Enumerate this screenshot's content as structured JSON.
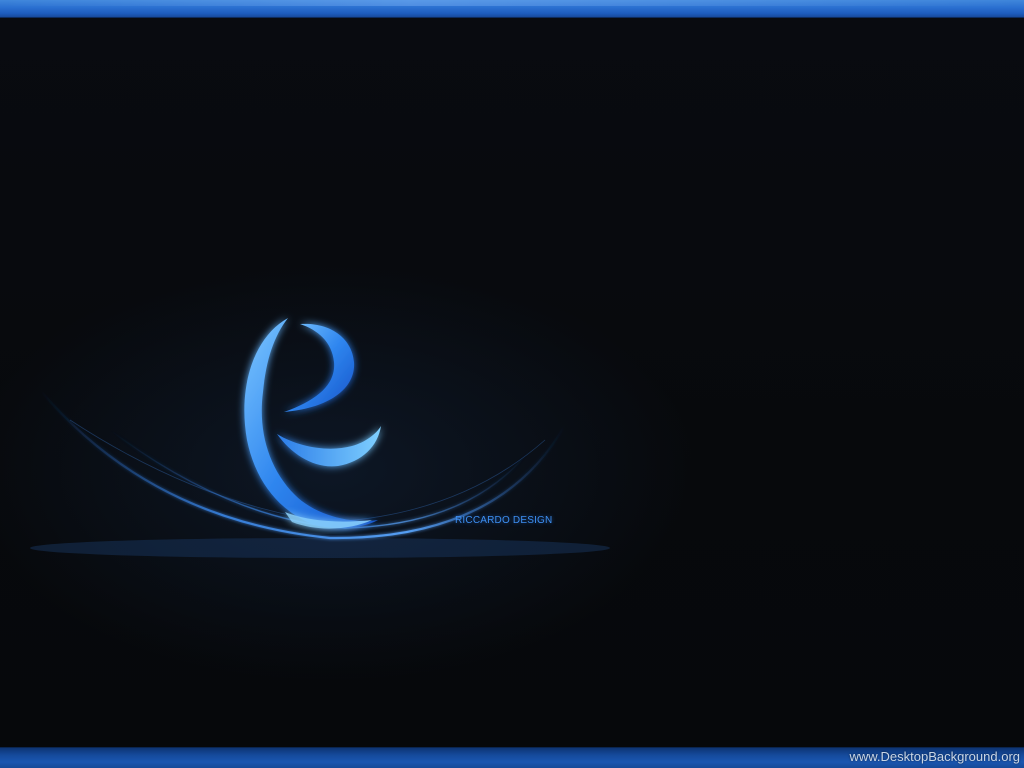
{
  "wallpaper": {
    "credit": "RICCARDO DESIGN",
    "watermark": "www.DesktopBackground.org",
    "logo_icon": "stylized-letter-e-icon",
    "accent_color": "#2f86ef",
    "background_color": "#07090d",
    "bar_color": "#1d5cbd"
  }
}
